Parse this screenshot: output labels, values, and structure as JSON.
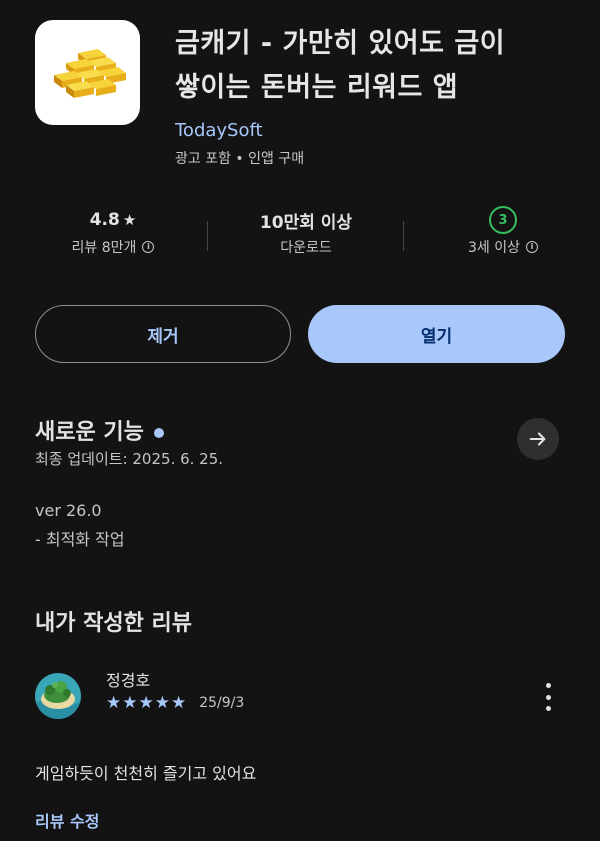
{
  "app": {
    "title_line1": "금캐기 - 가만히 있어도 금이",
    "title_line2": "쌓이는 돈버는 리워드 앱",
    "developer": "TodaySoft",
    "sub_info": "광고 포함 • 인앱 구매",
    "icon": "gold-bars-icon"
  },
  "stats": {
    "rating": "4.8",
    "rating_star": "★",
    "reviews_label": "리뷰 8만개",
    "downloads": "10만회 이상",
    "downloads_label": "다운로드",
    "age_badge": "3",
    "age_label": "3세 이상"
  },
  "buttons": {
    "remove": "제거",
    "open": "열기"
  },
  "whats_new": {
    "title": "새로운 기능",
    "updated": "최종 업데이트: 2025. 6. 25.",
    "version": "ver 26.0",
    "note": "- 최적화 작업"
  },
  "my_review": {
    "title": "내가 작성한 리뷰",
    "reviewer": "정경호",
    "stars": "★★★★★",
    "rating_value": 5,
    "date": "25/9/3",
    "text": "게임하듯이 천천히 즐기고 있어요",
    "edit": "리뷰 수정"
  },
  "colors": {
    "background": "#131313",
    "accent": "#a8c7fa",
    "age_green": "#37be5f",
    "open_button_text": "#062e6f"
  }
}
